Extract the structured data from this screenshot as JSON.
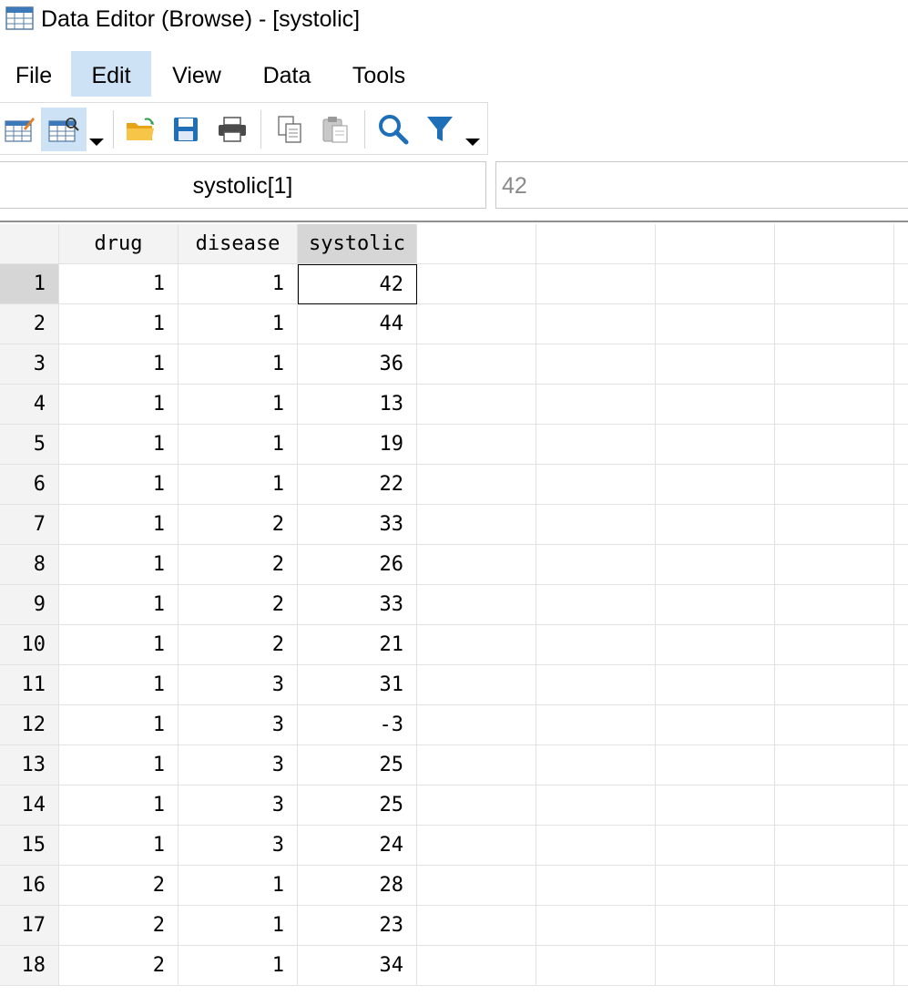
{
  "window": {
    "title": "Data Editor (Browse) - [systolic]"
  },
  "menu": [
    "File",
    "Edit",
    "View",
    "Data",
    "Tools"
  ],
  "cell_reference": {
    "name": "systolic[1]",
    "value": "42"
  },
  "columns": [
    "drug",
    "disease",
    "systolic"
  ],
  "rows": [
    {
      "n": "1",
      "drug": "1",
      "disease": "1",
      "systolic": "42"
    },
    {
      "n": "2",
      "drug": "1",
      "disease": "1",
      "systolic": "44"
    },
    {
      "n": "3",
      "drug": "1",
      "disease": "1",
      "systolic": "36"
    },
    {
      "n": "4",
      "drug": "1",
      "disease": "1",
      "systolic": "13"
    },
    {
      "n": "5",
      "drug": "1",
      "disease": "1",
      "systolic": "19"
    },
    {
      "n": "6",
      "drug": "1",
      "disease": "1",
      "systolic": "22"
    },
    {
      "n": "7",
      "drug": "1",
      "disease": "2",
      "systolic": "33"
    },
    {
      "n": "8",
      "drug": "1",
      "disease": "2",
      "systolic": "26"
    },
    {
      "n": "9",
      "drug": "1",
      "disease": "2",
      "systolic": "33"
    },
    {
      "n": "10",
      "drug": "1",
      "disease": "2",
      "systolic": "21"
    },
    {
      "n": "11",
      "drug": "1",
      "disease": "3",
      "systolic": "31"
    },
    {
      "n": "12",
      "drug": "1",
      "disease": "3",
      "systolic": "-3"
    },
    {
      "n": "13",
      "drug": "1",
      "disease": "3",
      "systolic": "25"
    },
    {
      "n": "14",
      "drug": "1",
      "disease": "3",
      "systolic": "25"
    },
    {
      "n": "15",
      "drug": "1",
      "disease": "3",
      "systolic": "24"
    },
    {
      "n": "16",
      "drug": "2",
      "disease": "1",
      "systolic": "28"
    },
    {
      "n": "17",
      "drug": "2",
      "disease": "1",
      "systolic": "23"
    },
    {
      "n": "18",
      "drug": "2",
      "disease": "1",
      "systolic": "34"
    }
  ],
  "colors": {
    "selection": "#cde3f5",
    "header_bg": "#f3f3f3",
    "selected_header": "#d6d6d6",
    "accent_blue": "#1f6fb8",
    "folder": "#f0b429"
  },
  "icons": [
    "data-editor-edit-icon",
    "data-editor-browse-icon",
    "open-folder-icon",
    "save-icon",
    "print-icon",
    "copy-icon",
    "paste-icon",
    "search-icon",
    "filter-icon"
  ]
}
